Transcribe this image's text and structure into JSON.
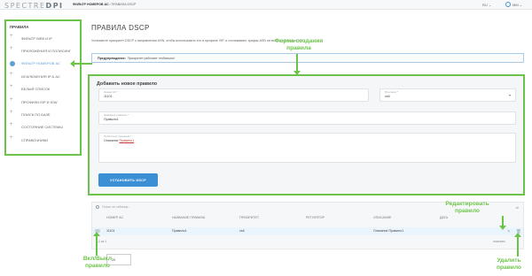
{
  "header": {
    "logo_light": "SPECTRE",
    "logo_bold": "DPI",
    "breadcrumb_bold": "ФИЛЬТР НОМЕРОВ АС",
    "breadcrumb_rest": " / ПРАВИЛА DSCP",
    "lang": "RU ⌄",
    "user": "MM ⌄"
  },
  "sidebar": {
    "title": "ПРАВИЛА",
    "items": [
      {
        "label": "ФИЛЬТР WEB И IP"
      },
      {
        "label": "ПРИЛОЖЕНИЯ И ПОЛИСИНГ"
      },
      {
        "label": "ФИЛЬТР НОМЕРОВ АС"
      },
      {
        "label": "ИСКЛЮЧЕНИЯ IP & АС"
      },
      {
        "label": "БЕЛЫЙ СПИСОК"
      },
      {
        "label": "ПРОФИЛИ ISP И IGW"
      },
      {
        "label": "ПОИСК ПО БАЗЕ"
      },
      {
        "label": "СОСТОЯНИЕ СИСТЕМЫ"
      },
      {
        "label": "СПРАВОЧНИКИ"
      }
    ]
  },
  "main": {
    "title": "ПРАВИЛА DSCP",
    "description": "Установите приоритет DSCP о направлении ASN, чтобы использовать его в профиле ISP, и отслеживать трафик ASN на всех устройствах DPI.",
    "alert_label": "Предупреждение:",
    "alert_text": "Приоритет работает глобально!"
  },
  "form": {
    "title": "Добавить новое правило",
    "as_number_label": "Номер АС *",
    "as_number_value": "11101",
    "protocol_label": "Протокол *",
    "protocol_value": "cs6",
    "rule_name_label": "Название правила *",
    "rule_name_value": "Правило1",
    "public_desc_label": "Публичное описание *",
    "public_desc_prefix": "Описание ",
    "public_desc_link": "Правило1",
    "submit_label": "УСТАНОВИТЬ DSCP"
  },
  "table": {
    "search_placeholder": "Поиск по таблице...",
    "columns": [
      "НОМЕР АС",
      "НАЗВАНИЕ ПРАВИЛА",
      "ПРИОРИТЕТ",
      "РЕГУЛЯТОР",
      "ОПИСАНИЕ",
      "ДАТА"
    ],
    "rows": [
      {
        "as": "11101",
        "name": "Правило1",
        "priority": "cs6",
        "regulator": "",
        "description": "Описание Правило1",
        "date": ""
      }
    ],
    "footer_left": "1-1 из 1",
    "footer_right": "показать",
    "per_page": "20"
  },
  "annotations": {
    "form": "Форма создания\nправила",
    "edit": "Редактировать\nправило",
    "toggle": "Вкл/Выкл\nправило",
    "delete": "Удалить\nправило"
  },
  "colors": {
    "annotation": "#6cc34a",
    "accent": "#3b8fd4",
    "active_nav": "#5fa0d8"
  }
}
